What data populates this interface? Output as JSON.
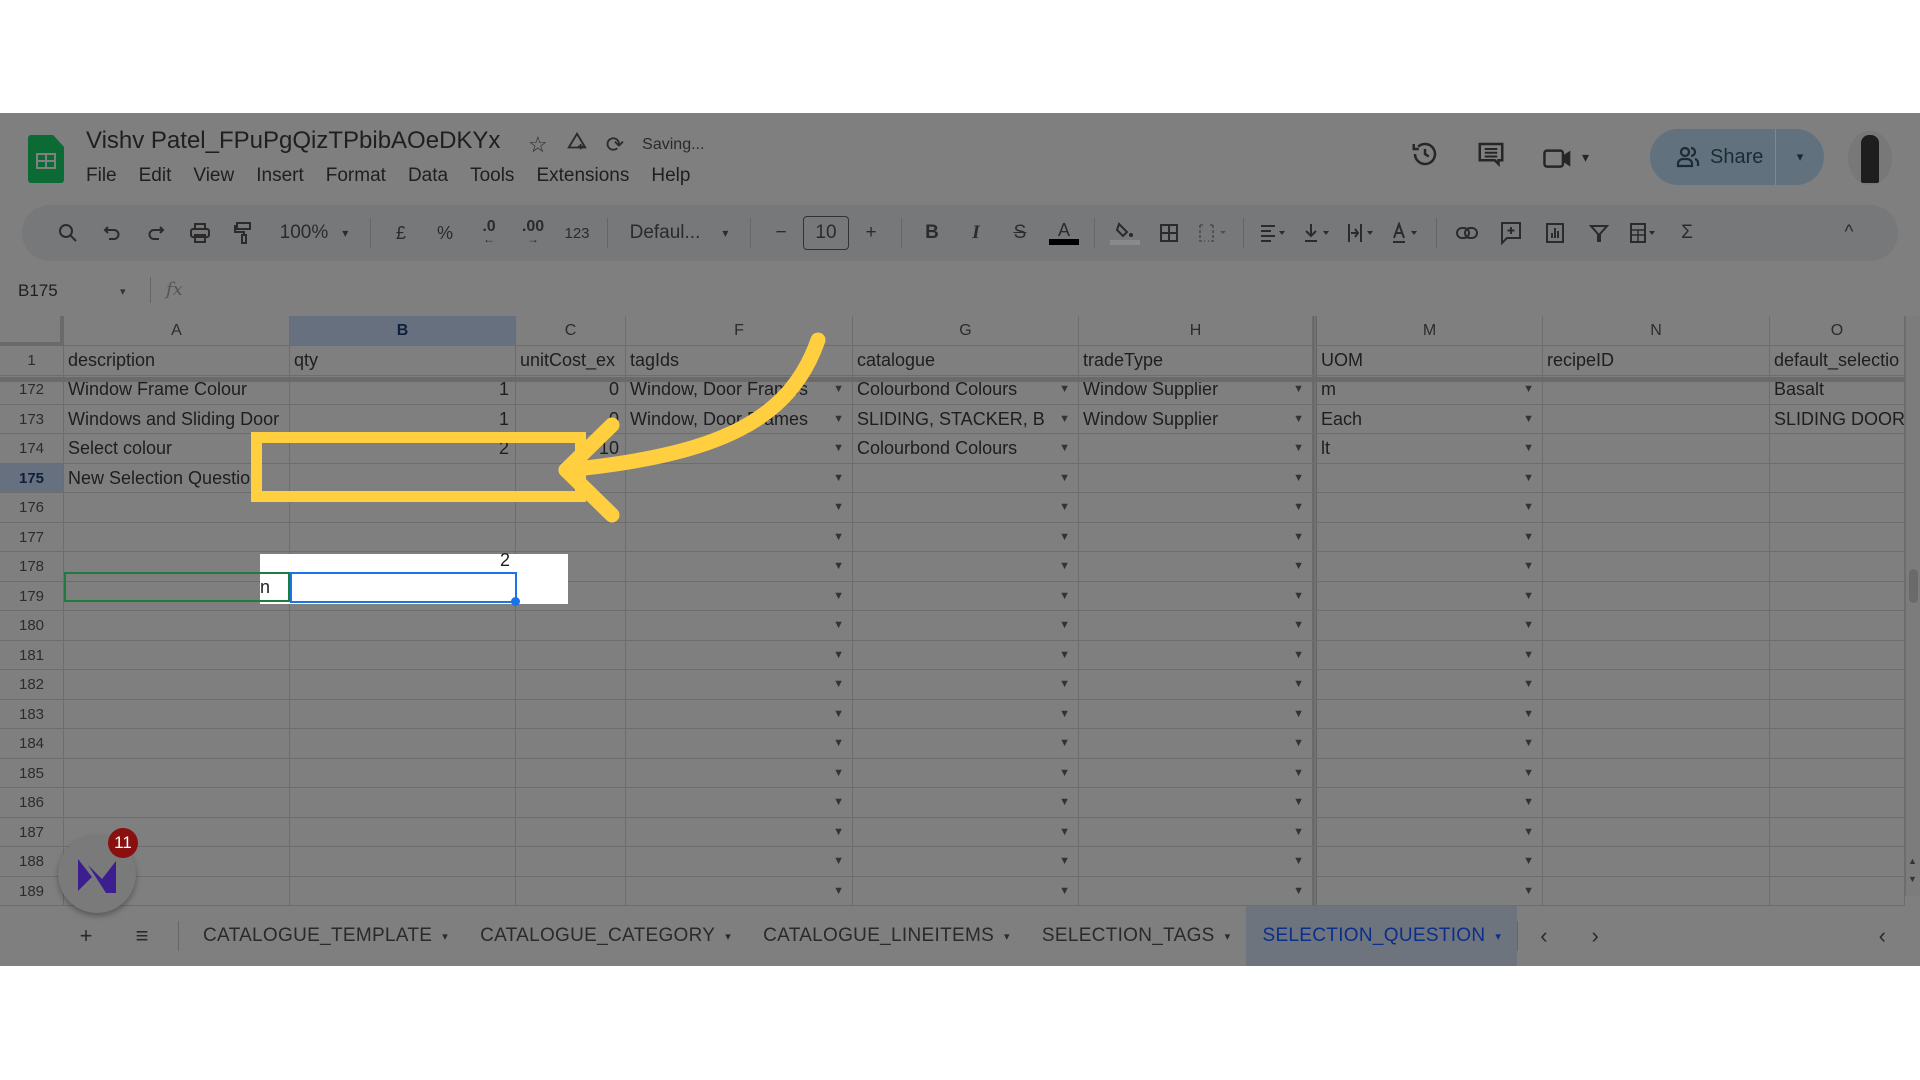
{
  "app": {
    "doc_title": "Vishv Patel_FPuPgQizTPbibAOeDKYx",
    "status": "Saving...",
    "menu": [
      "File",
      "Edit",
      "View",
      "Insert",
      "Format",
      "Data",
      "Tools",
      "Extensions",
      "Help"
    ],
    "share_label": "Share",
    "icons": {
      "star": "☆",
      "drive": "⛛",
      "sync": "⟳",
      "history": "⟲",
      "comments": "▤",
      "meet": "▭",
      "people": "⚇",
      "caret": "▾"
    }
  },
  "toolbar": {
    "zoom": "100%",
    "currency": "£",
    "percent": "%",
    "dec_decrease": ".0",
    "dec_increase": ".00",
    "format_123": "123",
    "font": "Defaul...",
    "font_size": "10",
    "minus": "−",
    "plus": "+",
    "bold": "B",
    "italic": "I",
    "strike": "S",
    "text_color": "A",
    "sigma": "Σ",
    "collapse": "^"
  },
  "formula_bar": {
    "name_box": "B175",
    "fx": "fx",
    "value": ""
  },
  "sheet": {
    "columns": [
      "A",
      "B",
      "C",
      "F",
      "G",
      "H",
      "M",
      "N",
      "O"
    ],
    "header_row": {
      "row_num": "1",
      "cells": [
        "description",
        "qty",
        "unitCost_ex",
        "tagIds",
        "catalogue",
        "tradeType",
        "UOM",
        "recipeID",
        "default_selectio"
      ]
    },
    "rows": [
      {
        "row_num": "172",
        "cells": [
          "Window Frame Colour",
          "1",
          "0",
          "Window, Door Frames",
          "Colourbond Colours",
          "Window Supplier",
          "m",
          "",
          "Basalt"
        ]
      },
      {
        "row_num": "173",
        "cells": [
          "Windows and Sliding Door",
          "1",
          "0",
          "Window, Door Frames",
          "SLIDING, STACKER, B",
          "Window Supplier",
          "Each",
          "",
          "SLIDING DOOR"
        ]
      },
      {
        "row_num": "174",
        "cells": [
          "Select colour",
          "2",
          "10",
          "",
          "Colourbond Colours",
          "",
          "lt",
          "",
          ""
        ]
      },
      {
        "row_num": "175",
        "cells": [
          "New Selection Question",
          "",
          "",
          "",
          "",
          "",
          "",
          "",
          ""
        ]
      },
      {
        "row_num": "176",
        "cells": [
          "",
          "",
          "",
          "",
          "",
          "",
          "",
          "",
          ""
        ]
      },
      {
        "row_num": "177",
        "cells": [
          "",
          "",
          "",
          "",
          "",
          "",
          "",
          "",
          ""
        ]
      },
      {
        "row_num": "178",
        "cells": [
          "",
          "",
          "",
          "",
          "",
          "",
          "",
          "",
          ""
        ]
      },
      {
        "row_num": "179",
        "cells": [
          "",
          "",
          "",
          "",
          "",
          "",
          "",
          "",
          ""
        ]
      },
      {
        "row_num": "180",
        "cells": [
          "",
          "",
          "",
          "",
          "",
          "",
          "",
          "",
          ""
        ]
      },
      {
        "row_num": "181",
        "cells": [
          "",
          "",
          "",
          "",
          "",
          "",
          "",
          "",
          ""
        ]
      },
      {
        "row_num": "182",
        "cells": [
          "",
          "",
          "",
          "",
          "",
          "",
          "",
          "",
          ""
        ]
      },
      {
        "row_num": "183",
        "cells": [
          "",
          "",
          "",
          "",
          "",
          "",
          "",
          "",
          ""
        ]
      },
      {
        "row_num": "184",
        "cells": [
          "",
          "",
          "",
          "",
          "",
          "",
          "",
          "",
          ""
        ]
      },
      {
        "row_num": "185",
        "cells": [
          "",
          "",
          "",
          "",
          "",
          "",
          "",
          "",
          ""
        ]
      },
      {
        "row_num": "186",
        "cells": [
          "",
          "",
          "",
          "",
          "",
          "",
          "",
          "",
          ""
        ]
      },
      {
        "row_num": "187",
        "cells": [
          "",
          "",
          "",
          "",
          "",
          "",
          "",
          "",
          ""
        ]
      },
      {
        "row_num": "188",
        "cells": [
          "",
          "",
          "",
          "",
          "",
          "",
          "",
          "",
          ""
        ]
      },
      {
        "row_num": "189",
        "cells": [
          "",
          "",
          "",
          "",
          "",
          "",
          "",
          "",
          ""
        ]
      }
    ],
    "selected_cell": "B175"
  },
  "tabs": {
    "add": "+",
    "all_sheets": "≡",
    "items": [
      {
        "label": "CATALOGUE_TEMPLATE",
        "active": false
      },
      {
        "label": "CATALOGUE_CATEGORY",
        "active": false
      },
      {
        "label": "CATALOGUE_LINEITEMS",
        "active": false
      },
      {
        "label": "SELECTION_TAGS",
        "active": false
      },
      {
        "label": "SELECTION_QUESTION",
        "active": true
      }
    ],
    "prev": "‹",
    "next": "›",
    "collapse": "‹"
  },
  "widget": {
    "badge_count": "11"
  },
  "annotation": {
    "highlight_color": "#ffcf40"
  }
}
